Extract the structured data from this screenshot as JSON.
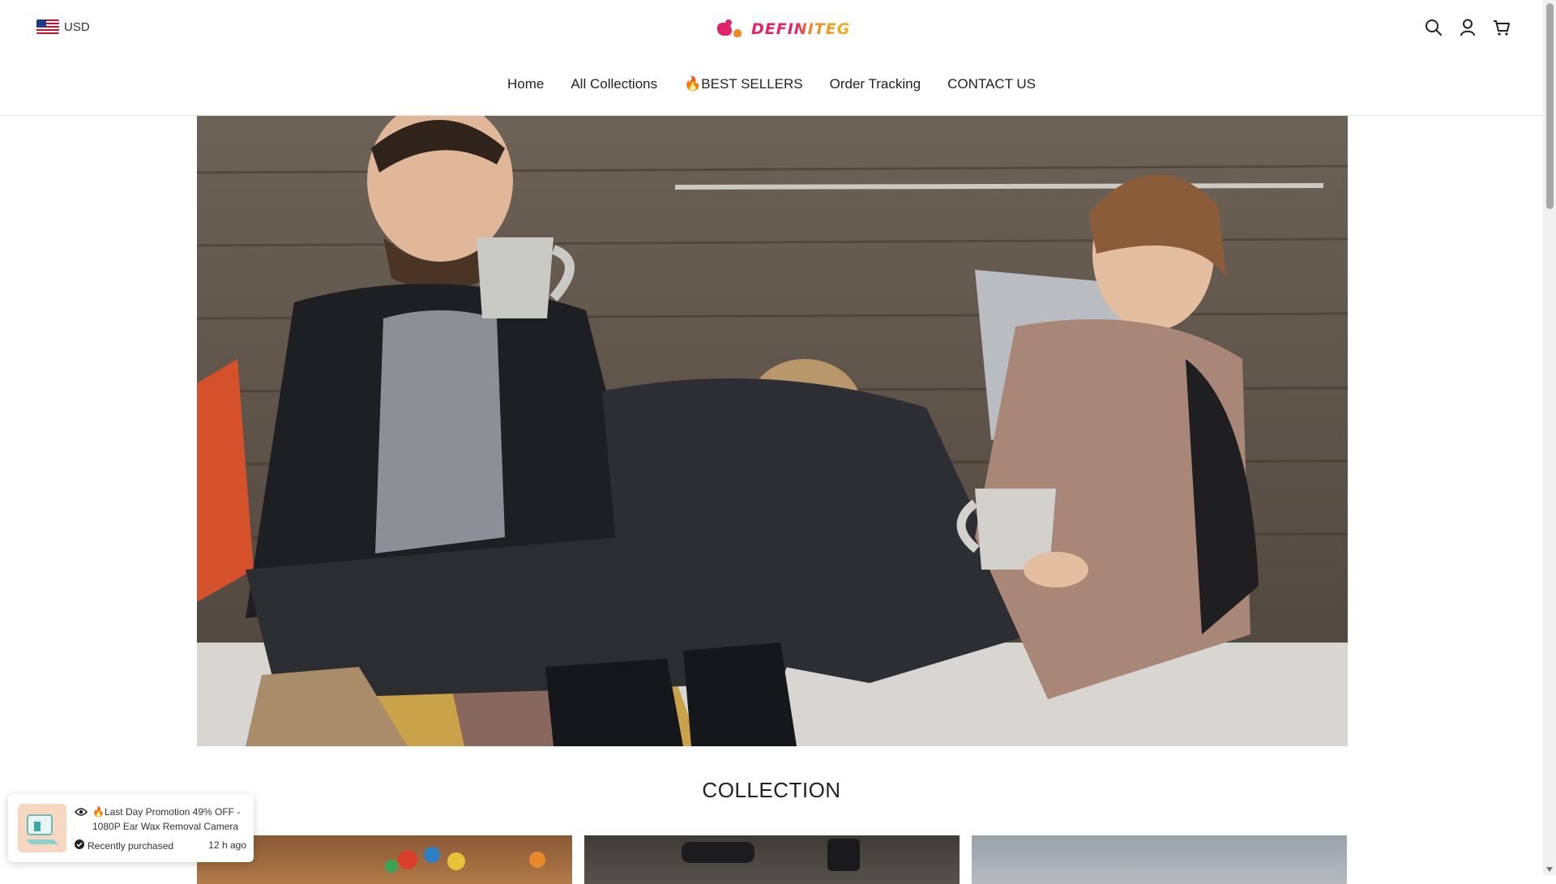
{
  "header": {
    "currency": "USD",
    "logo_text": "DEFINITEG",
    "nav": [
      "Home",
      "All Collections",
      "🔥BEST SELLERS",
      "Order Tracking",
      "CONTACT US"
    ]
  },
  "icons": {
    "search": "search-icon",
    "account": "account-icon",
    "cart": "cart-icon"
  },
  "collection": {
    "title": "COLLECTION"
  },
  "popup": {
    "title": "🔥Last Day Promotion 49% OFF - 1080P Ear Wax Removal Camera",
    "status": "Recently purchased",
    "time": "12 h ago"
  },
  "colors": {
    "brand_pink": "#e0246c",
    "brand_orange": "#f08a24"
  }
}
